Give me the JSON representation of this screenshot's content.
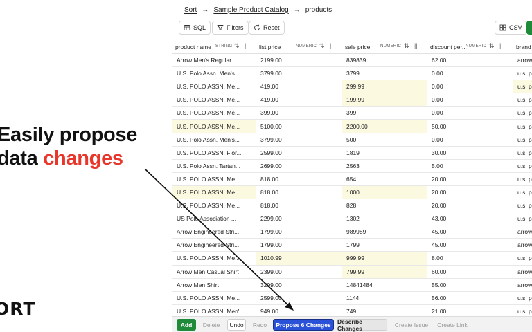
{
  "promo": {
    "line1": "Easily propose",
    "line2_plain": "data ",
    "line2_accent": "changes",
    "logo": "ORT",
    "accent_color": "#e8362b"
  },
  "breadcrumb": {
    "root": "Sort",
    "catalog": "Sample Product Catalog",
    "table": "products"
  },
  "toolbar": {
    "sql": "SQL",
    "filters": "Filters",
    "reset": "Reset",
    "csv": "CSV"
  },
  "columns": [
    {
      "name": "product name",
      "type": "STRING"
    },
    {
      "name": "list price",
      "type": "NUMERIC"
    },
    {
      "name": "sale price",
      "type": "NUMERIC"
    },
    {
      "name": "discount per...",
      "type": "NUMERIC"
    },
    {
      "name": "brand",
      "type": ""
    }
  ],
  "rows": [
    {
      "cells": [
        "Arrow Men's Regular ...",
        "2199.00",
        "839839",
        "62.00",
        "arrow"
      ],
      "changed": [
        false,
        false,
        false,
        false,
        false
      ]
    },
    {
      "cells": [
        "U.S. Polo Assn. Men's...",
        "3799.00",
        "3799",
        "0.00",
        "u.s. p"
      ],
      "changed": [
        false,
        false,
        false,
        false,
        false
      ]
    },
    {
      "cells": [
        "U.S. POLO ASSN. Me...",
        "419.00",
        "299.99",
        "0.00",
        "u.s. p"
      ],
      "changed": [
        false,
        false,
        true,
        false,
        true
      ]
    },
    {
      "cells": [
        "U.S. POLO ASSN. Me...",
        "419.00",
        "199.99",
        "0.00",
        "u.s. p"
      ],
      "changed": [
        false,
        false,
        true,
        false,
        false
      ]
    },
    {
      "cells": [
        "U.S. POLO ASSN. Me...",
        "399.00",
        "399",
        "0.00",
        "u.s. p"
      ],
      "changed": [
        false,
        false,
        false,
        false,
        false
      ]
    },
    {
      "cells": [
        "U.S. POLO ASSN. Me...",
        "5100.00",
        "2200.00",
        "50.00",
        "u.s. p"
      ],
      "changed": [
        true,
        false,
        true,
        false,
        false
      ]
    },
    {
      "cells": [
        "U.S. Polo Assn. Men's...",
        "3799.00",
        "500",
        "0.00",
        "u.s. p"
      ],
      "changed": [
        false,
        false,
        false,
        false,
        false
      ]
    },
    {
      "cells": [
        "U.S. POLO ASSN. Flor...",
        "2599.00",
        "1819",
        "30.00",
        "u.s. p"
      ],
      "changed": [
        false,
        false,
        false,
        false,
        false
      ]
    },
    {
      "cells": [
        "U.S. Polo Assn. Tartan...",
        "2699.00",
        "2563",
        "5.00",
        "u.s. p"
      ],
      "changed": [
        false,
        false,
        false,
        false,
        false
      ]
    },
    {
      "cells": [
        "U.S. POLO ASSN. Me...",
        "818.00",
        "654",
        "20.00",
        "u.s. p"
      ],
      "changed": [
        false,
        false,
        false,
        false,
        false
      ]
    },
    {
      "cells": [
        "U.S. POLO ASSN. Me...",
        "818.00",
        "1000",
        "20.00",
        "u.s. p"
      ],
      "changed": [
        true,
        false,
        true,
        false,
        false
      ]
    },
    {
      "cells": [
        "U.S. POLO ASSN. Me...",
        "818.00",
        "828",
        "20.00",
        "u.s. p"
      ],
      "changed": [
        false,
        false,
        false,
        false,
        false
      ]
    },
    {
      "cells": [
        "US Polo Association ...",
        "2299.00",
        "1302",
        "43.00",
        "u.s. p"
      ],
      "changed": [
        false,
        false,
        false,
        false,
        false
      ]
    },
    {
      "cells": [
        "Arrow Engineered Stri...",
        "1799.00",
        "989989",
        "45.00",
        "arrow"
      ],
      "changed": [
        false,
        false,
        false,
        false,
        false
      ]
    },
    {
      "cells": [
        "Arrow Engineered Stri...",
        "1799.00",
        "1799",
        "45.00",
        "arrow"
      ],
      "changed": [
        false,
        false,
        false,
        false,
        false
      ]
    },
    {
      "cells": [
        "U.S. POLO ASSN. Me...",
        "1010.99",
        "999.99",
        "8.00",
        "u.s. p"
      ],
      "changed": [
        false,
        true,
        true,
        false,
        false
      ]
    },
    {
      "cells": [
        "Arrow Men Casual Shirt",
        "2399.00",
        "799.99",
        "60.00",
        "arrow"
      ],
      "changed": [
        false,
        false,
        true,
        false,
        false
      ]
    },
    {
      "cells": [
        "Arrow Men Shirt",
        "3299.00",
        "14841484",
        "55.00",
        "arrow"
      ],
      "changed": [
        false,
        false,
        false,
        false,
        false
      ]
    },
    {
      "cells": [
        "U.S. POLO ASSN. Me...",
        "2599.00",
        "1144",
        "56.00",
        "u.s. p"
      ],
      "changed": [
        false,
        false,
        false,
        false,
        false
      ]
    },
    {
      "cells": [
        "U.S. POLO ASSN. Men'...",
        "949.00",
        "749",
        "21.00",
        "u.s. p"
      ],
      "changed": [
        false,
        false,
        false,
        false,
        false
      ]
    }
  ],
  "bottombar": {
    "add": "Add",
    "delete": "Delete",
    "undo": "Undo",
    "redo": "Redo",
    "propose": "Propose 6 Changes",
    "describe": "Describe Changes",
    "create_issue": "Create Issue",
    "create_link": "Create Link"
  },
  "colors": {
    "changed_cell": "#fcf9e1",
    "primary_green": "#1f8a3a",
    "propose_blue": "#2a52d9"
  },
  "icons": [
    "sql-icon",
    "filter-icon",
    "reset-icon",
    "csv-icon",
    "sort-icon",
    "column-grip-icon",
    "arrow-right-icon",
    "pointer-arrow-icon"
  ]
}
